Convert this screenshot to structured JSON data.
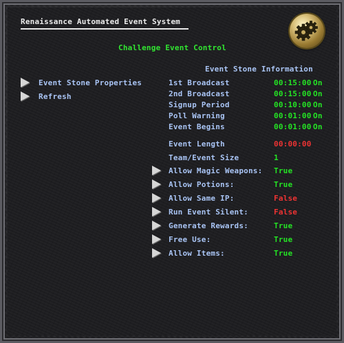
{
  "header": {
    "title": "Renaissance Automated Event System",
    "subtitle": "Challenge Event Control",
    "gear_icon": "gears-icon"
  },
  "left_menu": {
    "event_stone_properties": "Event Stone Properties",
    "refresh": "Refresh"
  },
  "info": {
    "title": "Event Stone Information",
    "first_broadcast": {
      "label": "1st Broadcast",
      "time": "00:15:00",
      "state": "On"
    },
    "second_broadcast": {
      "label": "2nd Broadcast",
      "time": "00:15:00",
      "state": "On"
    },
    "signup_period": {
      "label": "Signup Period",
      "time": "00:10:00",
      "state": "On"
    },
    "poll_warning": {
      "label": "Poll Warning",
      "time": "00:01:00",
      "state": "On"
    },
    "event_begins": {
      "label": "Event Begins",
      "time": "00:01:00",
      "state": "On"
    },
    "event_length": {
      "label": "Event Length",
      "time": "00:00:00"
    },
    "team_event_size": {
      "label": "Team/Event Size",
      "value": "1"
    }
  },
  "options": {
    "allow_magic_weapons": {
      "label": "Allow Magic Weapons:",
      "value": "True"
    },
    "allow_potions": {
      "label": "Allow Potions:",
      "value": "True"
    },
    "allow_same_ip": {
      "label": "Allow Same IP:",
      "value": "False"
    },
    "run_event_silent": {
      "label": "Run Event Silent:",
      "value": "False"
    },
    "generate_rewards": {
      "label": "Generate Rewards:",
      "value": "True"
    },
    "free_use": {
      "label": "Free Use:",
      "value": "True"
    },
    "allow_items": {
      "label": "Allow Items:",
      "value": "True"
    }
  },
  "colors": {
    "background": "#1e1e21",
    "label": "#a9c4f4",
    "true_green": "#24e324",
    "false_red": "#ee3333",
    "header_green": "#31e531",
    "title_white": "#ececec"
  }
}
